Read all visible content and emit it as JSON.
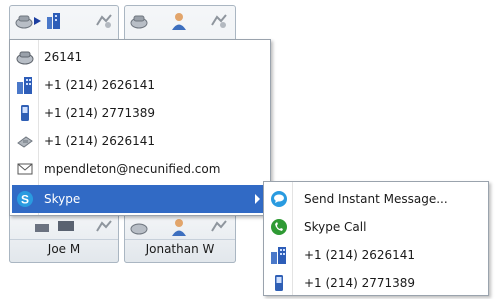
{
  "tiles": [
    {
      "name": ""
    },
    {
      "name": ""
    },
    {
      "name": "Joe M"
    },
    {
      "name": "Jonathan W"
    }
  ],
  "menu": {
    "items": [
      {
        "label": "26141",
        "icon": "phone-extension-icon"
      },
      {
        "label": "+1 (214) 2626141",
        "icon": "office-building-icon"
      },
      {
        "label": "+1 (214) 2771389",
        "icon": "mobile-phone-icon"
      },
      {
        "label": "+1 (214) 2626141",
        "icon": "desk-phone-icon"
      },
      {
        "label": "mpendleton@necunified.com",
        "icon": "email-icon"
      },
      {
        "label": "Skype",
        "icon": "skype-icon"
      }
    ]
  },
  "submenu": {
    "items": [
      {
        "label": "Send Instant Message...",
        "icon": "skype-chat-icon"
      },
      {
        "label": "Skype Call",
        "icon": "skype-call-icon"
      },
      {
        "label": "+1 (214) 2626141",
        "icon": "office-building-icon"
      },
      {
        "label": "+1 (214) 2771389",
        "icon": "mobile-phone-icon"
      }
    ]
  },
  "colors": {
    "highlight": "#316ac5",
    "skype_blue": "#2a9be0",
    "call_green": "#2f9a34"
  }
}
